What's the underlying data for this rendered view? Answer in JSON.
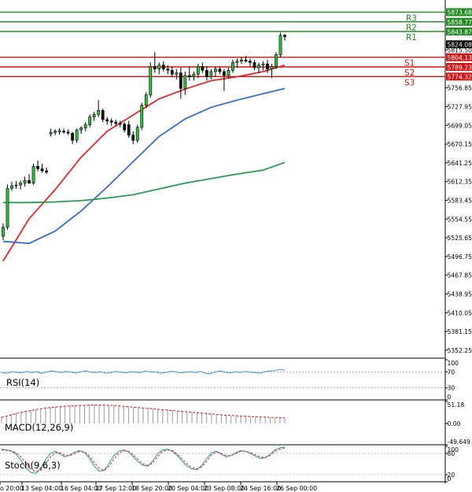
{
  "chart_data": [
    {
      "type": "candlestick",
      "pane": "main",
      "ylim": [
        5340,
        5890
      ],
      "yticks": [
        5873.68,
        5858.77,
        5843.87,
        5824.08,
        5815.5,
        5804.13,
        5789.23,
        5774.32,
        5756.85,
        5727.95,
        5699.05,
        5670.15,
        5641.25,
        5612.35,
        5583.45,
        5554.55,
        5525.65,
        5496.75,
        5467.85,
        5438.95,
        5410.05,
        5381.15,
        5352.25
      ],
      "xticks": [
        "o 20:00",
        "13 Sep 04:00",
        "16 Sep 04:00",
        "17 Sep 12:00",
        "18 Sep 20:00",
        "20 Sep 04:00",
        "23 Sep 08:00",
        "24 Sep 16:00",
        "26 Sep 00:00"
      ],
      "current_price": 5824.08,
      "candles": [
        [
          5528,
          5548,
          5522,
          5542
        ],
        [
          5542,
          5608,
          5538,
          5602
        ],
        [
          5602,
          5612,
          5598,
          5606
        ],
        [
          5606,
          5613,
          5601,
          5607
        ],
        [
          5607,
          5614,
          5600,
          5610
        ],
        [
          5610,
          5620,
          5605,
          5614
        ],
        [
          5614,
          5624,
          5609,
          5610
        ],
        [
          5610,
          5640,
          5607,
          5636
        ],
        [
          5636,
          5645,
          5628,
          5632
        ],
        [
          5632,
          5640,
          5626,
          5629
        ],
        [
          5629,
          5634,
          5624,
          5627
        ],
        [
          5686,
          5694,
          5682,
          5688
        ],
        [
          5688,
          5693,
          5684,
          5690
        ],
        [
          5689,
          5695,
          5685,
          5691
        ],
        [
          5690,
          5694,
          5686,
          5689
        ],
        [
          5689,
          5693,
          5684,
          5687
        ],
        [
          5687,
          5689,
          5670,
          5676
        ],
        [
          5676,
          5694,
          5672,
          5692
        ],
        [
          5692,
          5698,
          5686,
          5695
        ],
        [
          5695,
          5704,
          5690,
          5700
        ],
        [
          5700,
          5716,
          5696,
          5712
        ],
        [
          5712,
          5720,
          5706,
          5716
        ],
        [
          5716,
          5738,
          5712,
          5722
        ],
        [
          5722,
          5725,
          5704,
          5708
        ],
        [
          5708,
          5712,
          5700,
          5706
        ],
        [
          5706,
          5710,
          5698,
          5704
        ],
        [
          5704,
          5708,
          5698,
          5702
        ],
        [
          5702,
          5706,
          5696,
          5701
        ],
        [
          5701,
          5704,
          5688,
          5692
        ],
        [
          5700,
          5706,
          5680,
          5684
        ],
        [
          5684,
          5690,
          5670,
          5676
        ],
        [
          5676,
          5700,
          5672,
          5696
        ],
        [
          5696,
          5734,
          5692,
          5730
        ],
        [
          5730,
          5750,
          5726,
          5746
        ],
        [
          5746,
          5796,
          5742,
          5790
        ],
        [
          5790,
          5812,
          5780,
          5786
        ],
        [
          5786,
          5796,
          5778,
          5792
        ],
        [
          5792,
          5798,
          5782,
          5786
        ],
        [
          5786,
          5792,
          5778,
          5784
        ],
        [
          5784,
          5790,
          5774,
          5778
        ],
        [
          5778,
          5786,
          5770,
          5780
        ],
        [
          5780,
          5788,
          5740,
          5756
        ],
        [
          5756,
          5782,
          5746,
          5776
        ],
        [
          5776,
          5790,
          5768,
          5774
        ],
        [
          5774,
          5782,
          5768,
          5778
        ],
        [
          5778,
          5794,
          5772,
          5790
        ],
        [
          5790,
          5796,
          5780,
          5784
        ],
        [
          5784,
          5790,
          5768,
          5774
        ],
        [
          5774,
          5786,
          5770,
          5782
        ],
        [
          5782,
          5790,
          5774,
          5786
        ],
        [
          5786,
          5790,
          5778,
          5782
        ],
        [
          5782,
          5786,
          5752,
          5776
        ],
        [
          5776,
          5788,
          5772,
          5784
        ],
        [
          5784,
          5800,
          5780,
          5796
        ],
        [
          5796,
          5802,
          5788,
          5798
        ],
        [
          5798,
          5804,
          5794,
          5800
        ],
        [
          5800,
          5806,
          5796,
          5798
        ],
        [
          5798,
          5802,
          5790,
          5796
        ],
        [
          5796,
          5800,
          5784,
          5788
        ],
        [
          5788,
          5796,
          5780,
          5792
        ],
        [
          5792,
          5798,
          5784,
          5794
        ],
        [
          5794,
          5800,
          5780,
          5786
        ],
        [
          5786,
          5794,
          5772,
          5790
        ],
        [
          5790,
          5812,
          5786,
          5808
        ],
        [
          5808,
          5842,
          5804,
          5838
        ],
        [
          5838,
          5840,
          5830,
          5836
        ]
      ],
      "series": [
        {
          "name": "fast MA",
          "color": "#e8262a",
          "x": [
            0,
            6,
            12,
            18,
            24,
            30,
            36,
            42,
            48,
            54,
            60,
            65
          ],
          "values": [
            5490,
            5555,
            5600,
            5650,
            5690,
            5715,
            5740,
            5755,
            5768,
            5774,
            5782,
            5792
          ]
        },
        {
          "name": "mid MA",
          "color": "#3c6bd0",
          "x": [
            0,
            6,
            12,
            18,
            24,
            30,
            36,
            42,
            48,
            54,
            60,
            65
          ],
          "values": [
            5520,
            5517,
            5536,
            5567,
            5604,
            5643,
            5682,
            5709,
            5727,
            5738,
            5748,
            5756
          ]
        },
        {
          "name": "slow MA",
          "color": "#2a9a52",
          "x": [
            0,
            6,
            12,
            18,
            24,
            30,
            36,
            42,
            48,
            54,
            60,
            65
          ],
          "values": [
            5580,
            5580,
            5581,
            5583,
            5587,
            5592,
            5601,
            5610,
            5617,
            5624,
            5630,
            5642
          ]
        }
      ],
      "levels": [
        {
          "label": "R3",
          "value": 5873.68,
          "color": "#1f8a1f"
        },
        {
          "label": "R2",
          "value": 5858.77,
          "color": "#1f8a1f"
        },
        {
          "label": "R1",
          "value": 5843.87,
          "color": "#1f8a1f"
        },
        {
          "label": "S1",
          "value": 5804.13,
          "color": "#d11414"
        },
        {
          "label": "S2",
          "value": 5789.23,
          "color": "#d11414"
        },
        {
          "label": "S3",
          "value": 5774.32,
          "color": "#d11414"
        }
      ]
    },
    {
      "type": "line",
      "pane": "rsi",
      "title": "RSI(14)",
      "ylim": [
        0,
        100
      ],
      "yticks": [
        100,
        70,
        30,
        0
      ],
      "series": [
        {
          "color": "#3a8fd6",
          "values": [
            68,
            66,
            70,
            69,
            67,
            71,
            68,
            70,
            66,
            69,
            72,
            70,
            68,
            71,
            69,
            67,
            70,
            72,
            69,
            68,
            70,
            66,
            68,
            71,
            69,
            67,
            70,
            69,
            68,
            72,
            69,
            70,
            66,
            68,
            71,
            70,
            67,
            69,
            70,
            68,
            71,
            66,
            65,
            70,
            72,
            69,
            67,
            70,
            68,
            71,
            69,
            68,
            66,
            70,
            72,
            73,
            76,
            74
          ]
        }
      ]
    },
    {
      "type": "bar",
      "pane": "macd",
      "title": "MACD(12,26,9)",
      "ylim": [
        -49.649,
        51.18
      ],
      "yticks": [
        51.18,
        0.0,
        -49.649
      ],
      "values": [
        16,
        19,
        22,
        24,
        27,
        29,
        31,
        33,
        35,
        37,
        38,
        39,
        40,
        41,
        42,
        42,
        43,
        43,
        44,
        44,
        44,
        43,
        43,
        42,
        41,
        40,
        39,
        38,
        37,
        36,
        35,
        34,
        33,
        32,
        31,
        30,
        29,
        28,
        27,
        26,
        25,
        24,
        23,
        22,
        21,
        20,
        19,
        18,
        17,
        17,
        16,
        16,
        15,
        15,
        14,
        14,
        13,
        13,
        12
      ],
      "signal": [
        14,
        17,
        20,
        23,
        26,
        28,
        30,
        32,
        34,
        36,
        37,
        38,
        39,
        40,
        41,
        41,
        42,
        42,
        43,
        43,
        43,
        43,
        42,
        42,
        41,
        40,
        39,
        38,
        37,
        36,
        35,
        34,
        33,
        32,
        31,
        30,
        29,
        28,
        27,
        26,
        25,
        24,
        23,
        22,
        21,
        20,
        19,
        19,
        18,
        17,
        17,
        16,
        16,
        15,
        15,
        14,
        14,
        13,
        13
      ]
    },
    {
      "type": "line",
      "pane": "stoch",
      "title": "Stoch(9,6,3)",
      "ylim": [
        0,
        100
      ],
      "yticks": [
        100,
        80,
        20,
        0
      ],
      "series": [
        {
          "name": "%K",
          "color": "#1f9a9a",
          "values": [
            92,
            90,
            86,
            78,
            60,
            40,
            26,
            24,
            38,
            62,
            80,
            86,
            78,
            70,
            76,
            84,
            88,
            82,
            66,
            44,
            30,
            32,
            52,
            74,
            86,
            90,
            84,
            70,
            56,
            46,
            44,
            60,
            80,
            90,
            92,
            86,
            74,
            58,
            44,
            36,
            34,
            46,
            66,
            82,
            86,
            78,
            70,
            74,
            82,
            88,
            86,
            80,
            72,
            66,
            68,
            78,
            90,
            96,
            98
          ]
        },
        {
          "name": "%D",
          "color": "#e02020",
          "values": [
            90,
            89,
            87,
            82,
            70,
            52,
            36,
            28,
            32,
            50,
            70,
            82,
            82,
            74,
            74,
            80,
            86,
            84,
            72,
            54,
            38,
            32,
            44,
            64,
            80,
            88,
            86,
            76,
            62,
            50,
            46,
            54,
            72,
            86,
            90,
            88,
            78,
            64,
            50,
            40,
            36,
            42,
            58,
            76,
            84,
            80,
            74,
            74,
            80,
            86,
            86,
            82,
            76,
            70,
            68,
            74,
            86,
            92,
            96
          ]
        }
      ]
    }
  ]
}
